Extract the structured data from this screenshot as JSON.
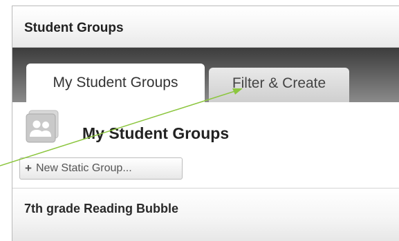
{
  "panel": {
    "title": "Student Groups"
  },
  "tabs": [
    {
      "label": "My Student Groups",
      "active": true
    },
    {
      "label": "Filter & Create",
      "active": false
    }
  ],
  "section": {
    "title": "My Student Groups",
    "icon": "people-group-icon"
  },
  "toolbar": {
    "new_group_label": "New Static Group...",
    "new_group_icon": "plus-icon"
  },
  "groups": [
    {
      "name": "7th grade Reading Bubble"
    }
  ],
  "annotation": {
    "arrow_color": "#8cc63f"
  }
}
